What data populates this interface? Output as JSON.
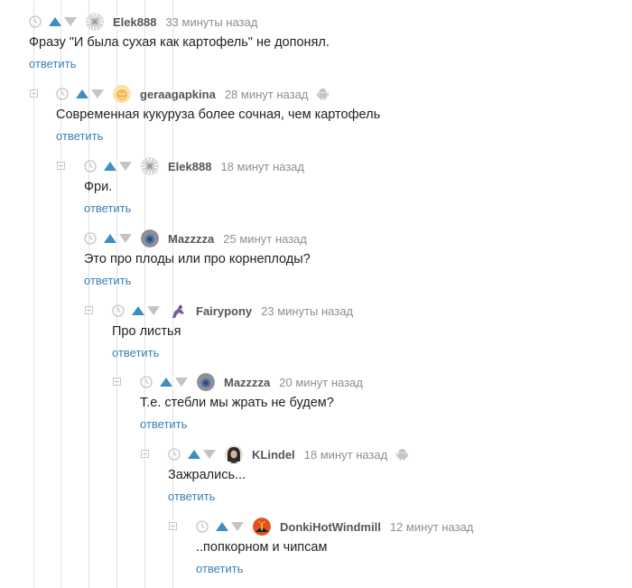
{
  "comments": [
    {
      "author": "Elek888",
      "time": "33 минуты назад",
      "text": "Фразу \"И была сухая как картофель\" не допонял.",
      "reply": "ответить",
      "mobile": false,
      "avatar": "snowflake-avatar"
    },
    {
      "author": "geraagapkina",
      "time": "28 минут назад",
      "text": "Современная кукуруза более сочная, чем картофель",
      "reply": "ответить",
      "mobile": true,
      "avatar": "orange-cartoon-avatar"
    },
    {
      "author": "Elek888",
      "time": "18 минут назад",
      "text": "Фри.",
      "reply": "ответить",
      "mobile": false,
      "avatar": "snowflake-avatar"
    },
    {
      "author": "Mazzzza",
      "time": "25 минут назад",
      "text": "Это про плоды или про корнеплоды?",
      "reply": "ответить",
      "mobile": false,
      "avatar": "grey-blue-avatar"
    },
    {
      "author": "Fairypony",
      "time": "23 минуты назад",
      "text": "Про листья",
      "reply": "ответить",
      "mobile": false,
      "avatar": "pony-avatar"
    },
    {
      "author": "Mazzzza",
      "time": "20 минут назад",
      "text": "Т.е. стебли мы жрать не будем?",
      "reply": "ответить",
      "mobile": false,
      "avatar": "grey-blue-avatar"
    },
    {
      "author": "KLindel",
      "time": "18 минут назад",
      "text": "Зажрались...",
      "reply": "ответить",
      "mobile": true,
      "avatar": "portrait-avatar"
    },
    {
      "author": "DonkiHotWindmill",
      "time": "12 минут назад",
      "text": "..попкорном и чипсам",
      "reply": "ответить",
      "mobile": false,
      "avatar": "windmill-avatar"
    }
  ],
  "colors": {
    "vote_up": "#3a8fbf",
    "vote_down": "#c4c4c4",
    "reply_link": "#3a7fb8",
    "author": "#555555",
    "time": "#8f8f8f"
  },
  "icons": {
    "clock": "clock-icon",
    "up": "arrow-up-icon",
    "down": "arrow-down-icon",
    "mobile": "android-icon",
    "collapse": "collapse-icon"
  }
}
